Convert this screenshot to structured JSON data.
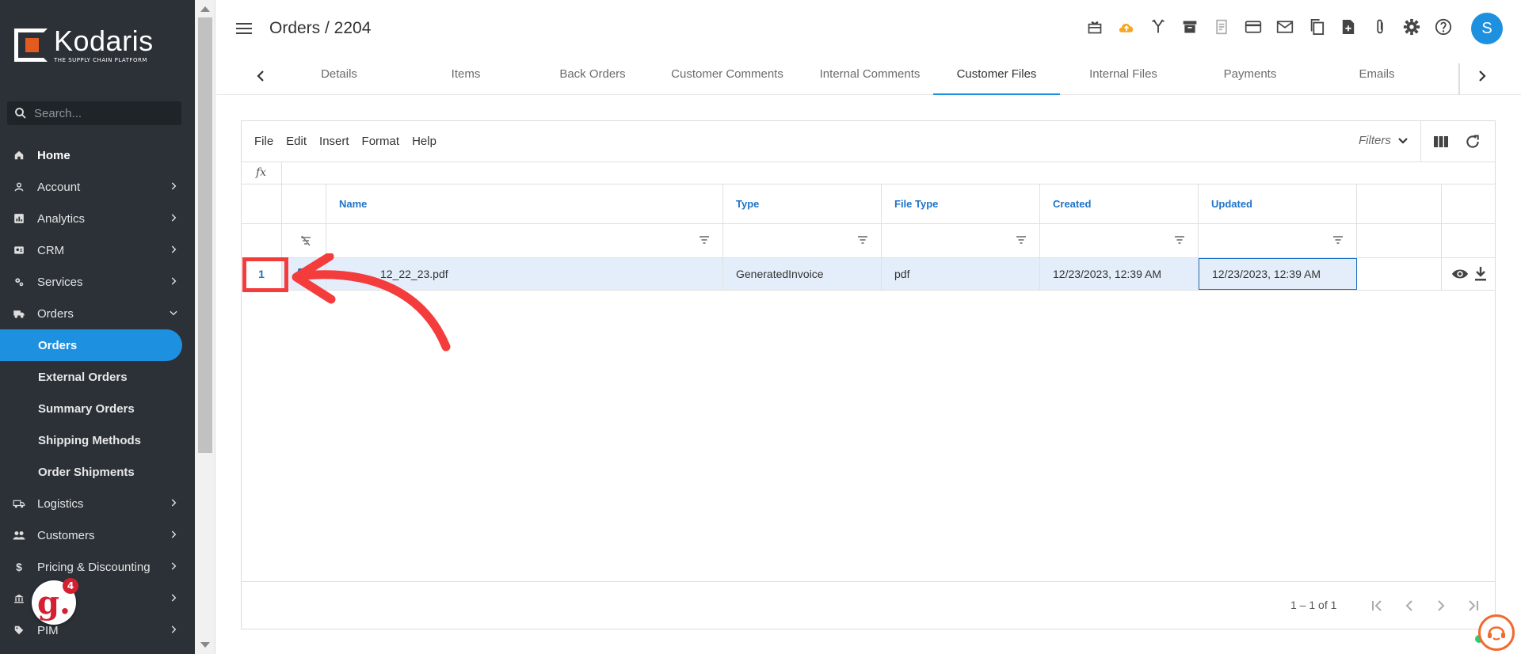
{
  "brand": {
    "name": "Kodaris",
    "tagline": "THE SUPPLY CHAIN PLATFORM",
    "accent": "#e35b1f"
  },
  "search": {
    "placeholder": "Search..."
  },
  "sidebar": {
    "items": [
      {
        "label": "Home",
        "icon": "home-icon",
        "expandable": false
      },
      {
        "label": "Account",
        "icon": "user-icon",
        "expandable": true
      },
      {
        "label": "Analytics",
        "icon": "analytics-icon",
        "expandable": true
      },
      {
        "label": "CRM",
        "icon": "contact-card-icon",
        "expandable": true
      },
      {
        "label": "Services",
        "icon": "services-gear-icon",
        "expandable": true
      },
      {
        "label": "Orders",
        "icon": "truck-icon",
        "expandable": true,
        "expanded": true
      }
    ],
    "orders_sub": [
      {
        "label": "Orders",
        "active": true
      },
      {
        "label": "External Orders"
      },
      {
        "label": "Summary Orders"
      },
      {
        "label": "Shipping Methods"
      },
      {
        "label": "Order Shipments"
      }
    ],
    "items_after": [
      {
        "label": "Logistics",
        "icon": "shipping-truck-icon"
      },
      {
        "label": "Customers",
        "icon": "people-icon"
      },
      {
        "label": "Pricing & Discounting",
        "icon": "dollar-icon"
      },
      {
        "label": "",
        "icon": "bank-icon"
      },
      {
        "label": "PIM",
        "icon": "tag-icon"
      }
    ],
    "badge_count": "4"
  },
  "header": {
    "title": "Orders / 2204",
    "avatar_initial": "S",
    "toolbar_icons": [
      "gift-icon",
      "cloud-upload-icon",
      "merge-icon",
      "archive-icon",
      "receipt-icon",
      "credit-card-icon",
      "mail-icon",
      "copy-icon",
      "add-file-icon",
      "attachment-icon",
      "settings-icon",
      "help-icon"
    ]
  },
  "tabs": [
    {
      "label": "Details"
    },
    {
      "label": "Items"
    },
    {
      "label": "Back Orders"
    },
    {
      "label": "Customer Comments"
    },
    {
      "label": "Internal Comments"
    },
    {
      "label": "Customer Files",
      "active": true
    },
    {
      "label": "Internal Files"
    },
    {
      "label": "Payments"
    },
    {
      "label": "Emails"
    }
  ],
  "grid": {
    "menu": [
      "File",
      "Edit",
      "Insert",
      "Format",
      "Help"
    ],
    "filters_label": "Filters",
    "fx_label": "fx",
    "columns": [
      "Name",
      "Type",
      "File Type",
      "Created",
      "Updated"
    ],
    "rows": [
      {
        "num": "1",
        "name": "12_22_23.pdf",
        "type": "GeneratedInvoice",
        "file_type": "pdf",
        "created": "12/23/2023, 12:39 AM",
        "updated": "12/23/2023, 12:39 AM"
      }
    ],
    "pager_text": "1 – 1 of 1"
  },
  "colors": {
    "primary": "#1e90e0",
    "sidebar_bg": "#2b3137",
    "annotation": "#f43c3c"
  }
}
